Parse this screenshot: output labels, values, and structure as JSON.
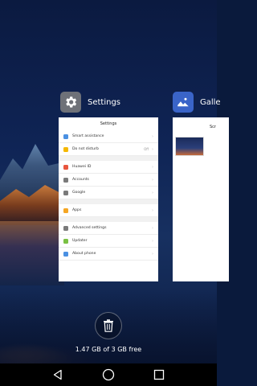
{
  "recents": {
    "settings": {
      "app_name": "Settings",
      "icon": "gear-icon",
      "screen_title": "Settings",
      "groups": [
        [
          {
            "label": "Smart assistance",
            "icon_color": "#4a90e2"
          },
          {
            "label": "Do not disturb",
            "value": "Off",
            "icon_color": "#f5b800"
          }
        ],
        [
          {
            "label": "Huawei ID",
            "icon_color": "#e8553e"
          },
          {
            "label": "Accounts",
            "icon_color": "#7a7a7a"
          },
          {
            "label": "Google",
            "icon_color": "#7a7a7a"
          }
        ],
        [
          {
            "label": "Apps",
            "icon_color": "#f5a623"
          }
        ],
        [
          {
            "label": "Advanced settings",
            "icon_color": "#7a7a7a"
          },
          {
            "label": "Updater",
            "icon_color": "#7ac143"
          },
          {
            "label": "About phone",
            "icon_color": "#4a90e2"
          }
        ]
      ]
    },
    "gallery": {
      "app_name": "Galle",
      "icon": "gallery-icon",
      "screen_title_partial": "Scr"
    }
  },
  "memory_text": "1.47 GB of 3 GB free",
  "nav": {
    "back_icon": "back-triangle-icon",
    "home_icon": "home-circle-icon",
    "recents_icon": "recents-square-icon"
  },
  "clear_icon": "trash-icon"
}
